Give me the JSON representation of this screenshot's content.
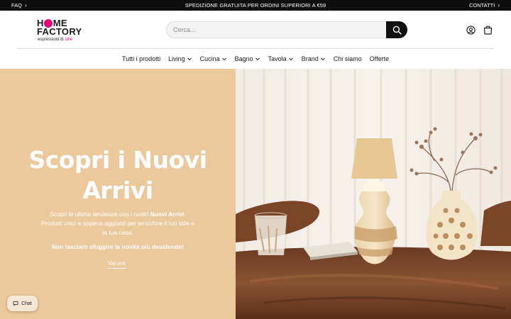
{
  "topbar": {
    "faq_label": "FAQ",
    "announcement": "SPEDIZIONE GRATUITA PER ORDINI SUPERIORI A €59",
    "contacts_label": "CONTATTI"
  },
  "brand": {
    "logo_line1_a": "H",
    "logo_line1_b": "ME",
    "logo_line2": "FACTORY",
    "tagline_a": "espressioni di ",
    "tagline_b": "stile",
    "accent_color": "#e4007c"
  },
  "search": {
    "placeholder": "Cerca..."
  },
  "nav": {
    "items": [
      {
        "label": "Tutti i prodotti"
      },
      {
        "label": "Living"
      },
      {
        "label": "Cucina"
      },
      {
        "label": "Bagno"
      },
      {
        "label": "Tavola"
      },
      {
        "label": "Brand"
      },
      {
        "label": "Chi siamo"
      },
      {
        "label": "Offerte"
      }
    ]
  },
  "hero": {
    "title": "Scopri i Nuovi Arrivi",
    "desc_a": "Scopri le ultime tendenze con i nostri ",
    "desc_bold": "Nuovi Arrivi",
    "desc_b": ". Prodotti unici e appena aggiunti per arricchire il tuo stile e la tua casa.",
    "cta_text": "Non lasciarti sfuggire le novità più desiderate!",
    "link_label": "Vai ora",
    "bg_color": "#ecc99d"
  },
  "chat": {
    "label": "Chat"
  },
  "icons": {
    "search": "search-icon",
    "account": "user-icon",
    "cart": "shopping-bag-icon",
    "chat": "chat-bubble-icon"
  }
}
